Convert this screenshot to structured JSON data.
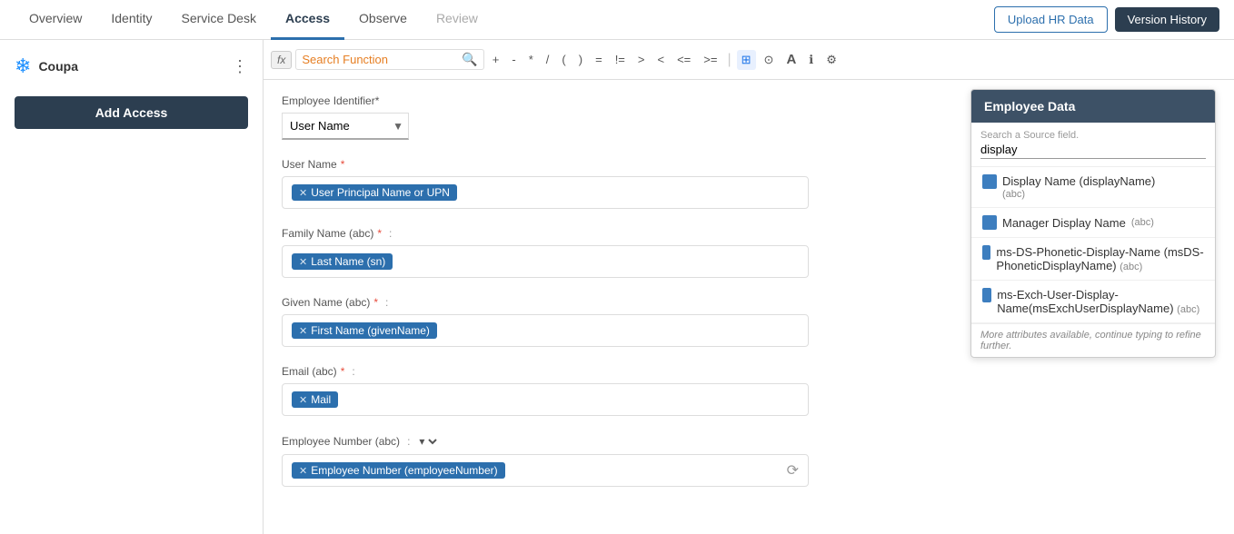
{
  "topNav": {
    "items": [
      {
        "label": "Overview",
        "active": false,
        "disabled": false
      },
      {
        "label": "Identity",
        "active": false,
        "disabled": false
      },
      {
        "label": "Service Desk",
        "active": false,
        "disabled": false
      },
      {
        "label": "Access",
        "active": true,
        "disabled": false
      },
      {
        "label": "Observe",
        "active": false,
        "disabled": false
      },
      {
        "label": "Review",
        "active": false,
        "disabled": true
      }
    ],
    "uploadHRLabel": "Upload HR Data",
    "versionHistoryLabel": "Version History"
  },
  "sidebar": {
    "companyName": "Coupa",
    "addAccessLabel": "Add Access",
    "menuIcon": "⋮"
  },
  "toolbar": {
    "fxLabel": "fx",
    "searchPlaceholder": "Search Function",
    "operators": [
      "+",
      "-",
      "*",
      "/",
      "(",
      ")",
      "=",
      "!=",
      ">",
      "<",
      "<=",
      ">="
    ],
    "iconButtons": [
      "grid-icon",
      "clock-icon",
      "text-icon",
      "info-icon",
      "settings-icon"
    ]
  },
  "form": {
    "employeeIdentifierLabel": "Employee Identifier*",
    "employeeIdentifierValue": "User Name",
    "fields": [
      {
        "label": "User Name",
        "required": true,
        "hasColon": false,
        "tagText": "User Principal Name or UPN",
        "showDropdown": false
      },
      {
        "label": "Family Name (abc)",
        "required": true,
        "hasColon": true,
        "tagText": "Last Name (sn)",
        "showDropdown": false
      },
      {
        "label": "Given Name (abc)",
        "required": true,
        "hasColon": true,
        "tagText": "First Name (givenName)",
        "showDropdown": false
      },
      {
        "label": "Email (abc)",
        "required": true,
        "hasColon": true,
        "tagText": "Mail",
        "showDropdown": false
      },
      {
        "label": "Employee Number (abc)",
        "required": false,
        "hasColon": true,
        "tagText": "Employee Number (employeeNumber)",
        "showDropdown": true
      }
    ]
  },
  "employeePanel": {
    "title": "Employee Data",
    "searchLabel": "Search a Source field.",
    "searchValue": "display",
    "items": [
      {
        "name": "Display Name (displayName)",
        "type": "(abc)"
      },
      {
        "name": "Manager Display Name",
        "type": "(abc)"
      },
      {
        "name": "ms-DS-Phonetic-Display-Name (msDS-PhoneticDisplayName)",
        "type": "(abc)"
      },
      {
        "name": "ms-Exch-User-Display-Name(msExchUserDisplayName)",
        "type": "(abc)"
      }
    ],
    "footerText": "More attributes available, continue typing to refine further."
  }
}
